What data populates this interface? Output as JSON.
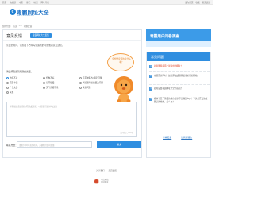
{
  "topbar": {
    "links": [
      "首页",
      "电视剧",
      "电影",
      "综艺",
      "动漫",
      "网址导航"
    ],
    "right_links": [
      "设为首页",
      "收藏",
      "意见反馈"
    ]
  },
  "logo": {
    "mark": "C",
    "title": "毒霸网址大全",
    "url": "www.duba.com"
  },
  "breadcrumb": [
    "您的位置:",
    "首页",
    ">>",
    "问题反馈"
  ],
  "feedback": {
    "title": "意见反馈",
    "badge": "毒霸网址大全反馈",
    "intro": "亲爱的用户，请您在下方填写您遇到的问题或者意见建议。",
    "bubble": "您想要反馈的是什么呢？",
    "choose_label": "请选择您遇到问题的类型：",
    "options": [
      {
        "label": "内容不对",
        "selected": true
      },
      {
        "label": "结构不好",
        "selected": false
      },
      {
        "label": "首页被篡改/锁定问题",
        "selected": false
      },
      {
        "label": "页面卡顿",
        "selected": false
      },
      {
        "label": "打开很慢",
        "selected": false
      },
      {
        "label": "浏览器导航被篡改问题",
        "selected": false
      },
      {
        "label": "广告太多",
        "selected": false
      },
      {
        "label": "天气预报不准",
        "selected": false
      },
      {
        "label": "其他问题",
        "selected": false
      },
      {
        "label": "其他",
        "selected": false
      }
    ],
    "textarea_placeholder": "详细描述您遇到的问题或建议，以便我们更好地改进",
    "textarea_counter": "还可输入200字",
    "contact_label": "联系方式：",
    "contact_placeholder": "请留下QQ号或手机号，方便我们及时反馈",
    "submit_label": "提交"
  },
  "banner": {
    "text": "毒霸用户问卷调查"
  },
  "faq": {
    "title": "常见问题",
    "items": [
      {
        "num": "1",
        "text": "如何删除毒霸上最常用的网址？",
        "hot": true
      },
      {
        "num": "2",
        "text": "在首页访问时，如何添加或删除最常访问的网站？",
        "hot": false
      },
      {
        "num": "3",
        "text": "如何设置毒霸网址大全为首页？",
        "hot": false
      },
      {
        "num": "4",
        "text": "模块下天气预报的城市显示不正确怎么办？下次打开又恢复默认的城市，怎么办？",
        "hot": false
      }
    ],
    "footer_links": [
      "查看更多",
      "给我们留言"
    ]
  },
  "footer": {
    "links": [
      "关于我们",
      "意见反馈"
    ],
    "badge_text": [
      "可信网站",
      "身份验证"
    ]
  }
}
